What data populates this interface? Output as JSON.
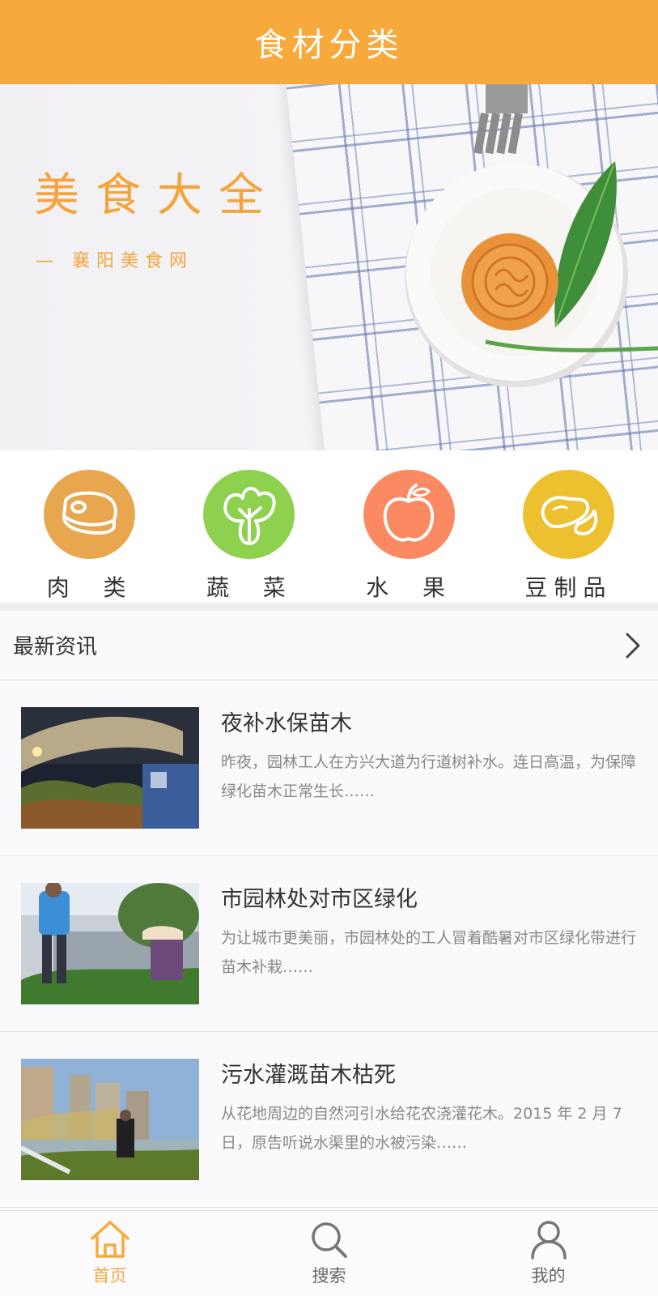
{
  "header": {
    "title": "食材分类"
  },
  "banner": {
    "title": "美食大全",
    "subtitle": "— 襄阳美食网",
    "accent": "#f4a43c"
  },
  "categories": [
    {
      "label": "肉  类",
      "icon": "meat-icon",
      "color": "#e8a64f"
    },
    {
      "label": "蔬  菜",
      "icon": "vegetable-icon",
      "color": "#8dd14f"
    },
    {
      "label": "水  果",
      "icon": "apple-icon",
      "color": "#fb8a62"
    },
    {
      "label": "豆制品",
      "icon": "bean-icon",
      "color": "#ecc02e"
    }
  ],
  "news": {
    "section_title": "最新资讯",
    "items": [
      {
        "title": "夜补水保苗木",
        "desc": "昨夜，园林工人在方兴大道为行道树补水。连日高温，为保障绿化苗木正常生长……"
      },
      {
        "title": "市园林处对市区绿化",
        "desc": "为让城市更美丽，市园林处的工人冒着酷暑对市区绿化带进行苗木补栽……"
      },
      {
        "title": "污水灌溉苗木枯死",
        "desc": "从花地周边的自然河引水给花农浇灌花木。2015 年 2 月 7 日，原告听说水渠里的水被污染……"
      }
    ]
  },
  "tabbar": {
    "items": [
      {
        "label": "首页",
        "icon": "home-icon",
        "active": true
      },
      {
        "label": "搜索",
        "icon": "search-icon",
        "active": false
      },
      {
        "label": "我的",
        "icon": "user-icon",
        "active": false
      }
    ],
    "active_color": "#f8a93b"
  }
}
